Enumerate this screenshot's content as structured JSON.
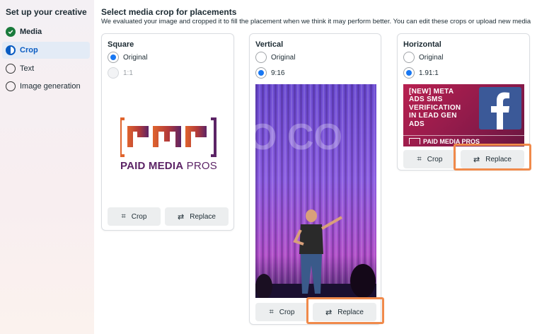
{
  "sidebar": {
    "title": "Set up your creative",
    "steps": [
      {
        "label": "Media",
        "state": "done"
      },
      {
        "label": "Crop",
        "state": "active"
      },
      {
        "label": "Text",
        "state": "pending"
      },
      {
        "label": "Image generation",
        "state": "pending"
      }
    ]
  },
  "main": {
    "heading": "Select media crop for placements",
    "subtext": "We evaluated your image and cropped it to fill the placement when we think it may perform better. You can edit these crops or upload new media"
  },
  "cards": {
    "square": {
      "title": "Square",
      "option1": "Original",
      "option2": "1:1",
      "selected": "Original",
      "logo_text_bold": "PAID MEDIA",
      "logo_text_light": "PROS",
      "crop_label": "Crop",
      "replace_label": "Replace"
    },
    "vertical": {
      "title": "Vertical",
      "option1": "Original",
      "option2": "9:16",
      "selected": "9:16",
      "crop_label": "Crop",
      "replace_label": "Replace"
    },
    "horizontal": {
      "title": "Horizontal",
      "option1": "Original",
      "option2": "1.91:1",
      "selected": "1.91:1",
      "banner_line1": "[NEW] META",
      "banner_line2": "ADS SMS",
      "banner_line3": "VERIFICATION",
      "banner_line4": "IN LEAD GEN",
      "banner_line5": "ADS",
      "banner_brand": "PAID MEDIA PROS",
      "crop_label": "Crop",
      "replace_label": "Replace"
    }
  },
  "colors": {
    "accent": "#1877f2",
    "done": "#1a7a3c",
    "highlight": "#f08a4b",
    "brand_orange": "#e0642d",
    "brand_purple": "#5c2466",
    "facebook_blue": "#3b5998",
    "banner_magenta": "#a0204f"
  }
}
